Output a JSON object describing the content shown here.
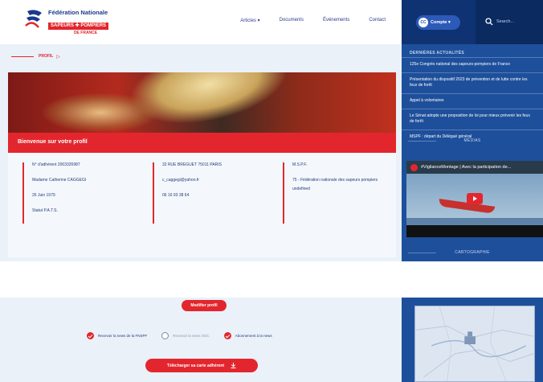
{
  "header": {
    "logo": {
      "line1": "Fédération Nationale",
      "line2": "SAPEURS ✚ POMPIERS",
      "line3": "DE FRANCE"
    },
    "nav": [
      {
        "label": "Articles ▾"
      },
      {
        "label": "Documents"
      },
      {
        "label": "Événements"
      },
      {
        "label": "Contact"
      }
    ]
  },
  "account": {
    "avatar": "CC",
    "label": "Compte ▾",
    "search_placeholder": "Search..."
  },
  "breadcrumb": {
    "label": "PROFIL",
    "arrow": "▷"
  },
  "welcome": "Bienvenue sur votre profil",
  "profile": {
    "col1": [
      "N° d'adhérent 2003326987",
      "Madame Catherine CAGGEGI",
      "26 Juin 1979",
      "Statut P.A.T.S."
    ],
    "col2": [
      "32 RUE BREGUET 75011 PARIS",
      "c_caggegi@yahoo.fr",
      "06 16 93 38 64"
    ],
    "col3": [
      "M.S.P.F.",
      "75 - Fédération nationale des sapeurs pompiers",
      "undefined"
    ]
  },
  "sidebar": {
    "news_title": "DERNIÈRES ACTUALITÉS",
    "news": [
      "125e Congrès national des sapeurs-pompiers de France",
      "Présentation du dispositif 2023 de prévention et de lutte contre les feux de forêt",
      "Appel à volontaires",
      "Le Sénat adopte une proposition de loi pour mieux prévenir les feux de forêt",
      "MSPF : départ du Délégué général"
    ],
    "media_title": "MÉDIAS",
    "video_title": "#VigilanceMontage | Avec la participation de...",
    "carto_title": "CARTOGRAPHIE"
  },
  "actions": {
    "modify": "Modifier profil",
    "checks": [
      {
        "label": "Recevoir la news de la FNSPF",
        "checked": true
      },
      {
        "label": "Recevoir la news ODC",
        "checked": false
      },
      {
        "label": "Abonnement à la news",
        "checked": true
      }
    ],
    "download": "Télécharger sa carte adhérent"
  },
  "colors": {
    "accent_red": "#e3262d",
    "navy": "#0f3272",
    "panel_blue": "#1e4f9b",
    "bg": "#eaf1f8"
  }
}
